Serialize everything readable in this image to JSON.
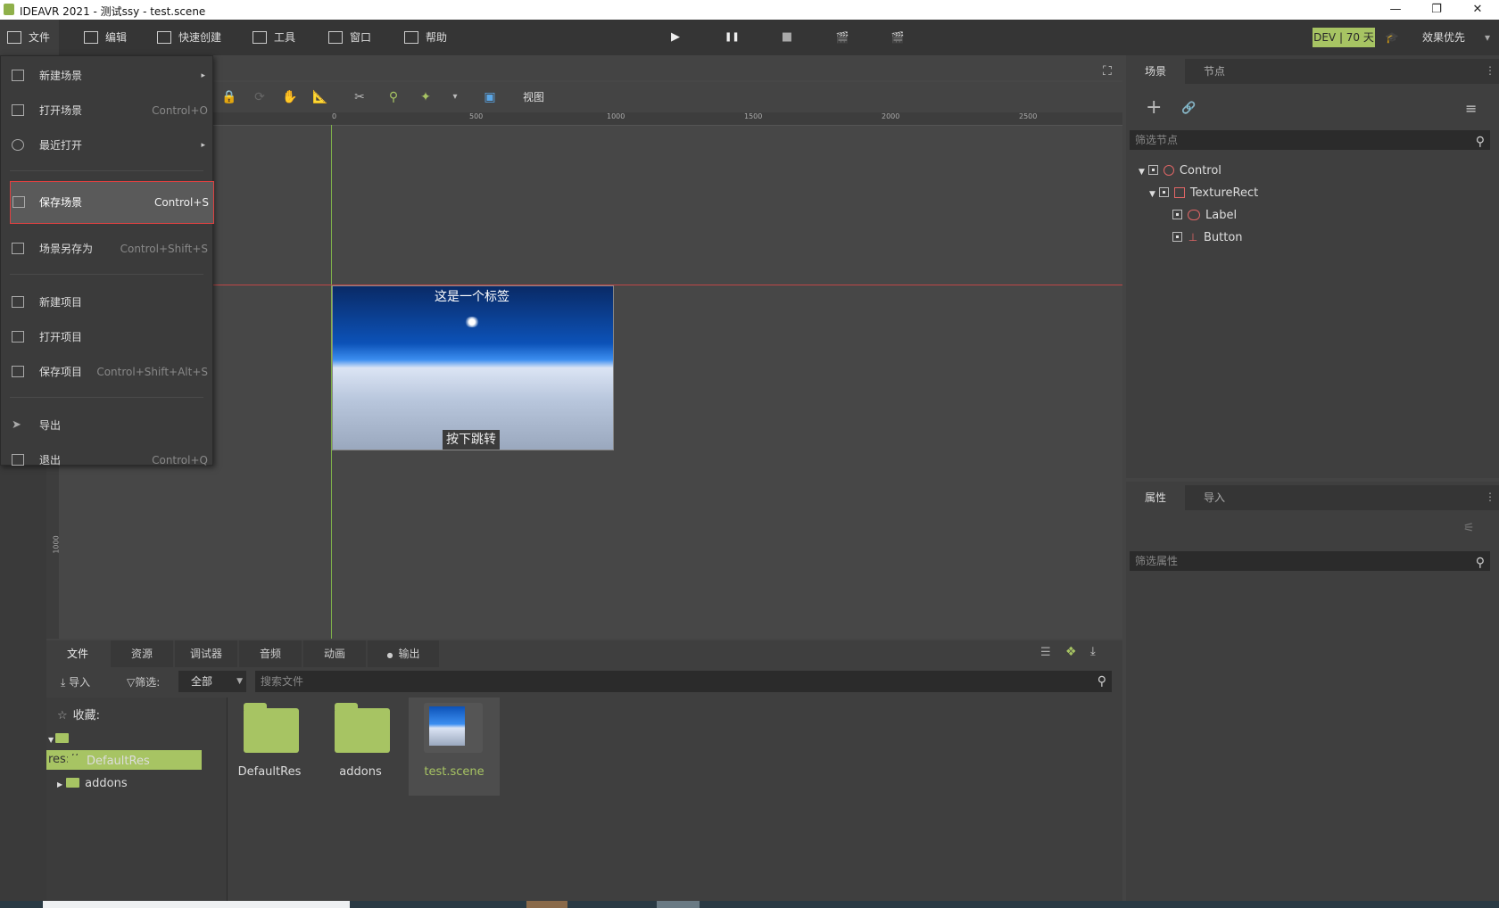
{
  "window": {
    "title": "IDEAVR 2021 - 测试ssy - test.scene",
    "minimize": "—",
    "restore": "❐",
    "close": "✕"
  },
  "menubar": {
    "items": [
      {
        "label": "文件"
      },
      {
        "label": "编辑"
      },
      {
        "label": "快速创建"
      },
      {
        "label": "工具"
      },
      {
        "label": "窗口"
      },
      {
        "label": "帮助"
      }
    ],
    "play": "▶",
    "pause": "❚❚",
    "stop": "■",
    "movie1": "🎬",
    "movie2": "🎬",
    "dev_badge": "DEV | 70 天",
    "cap": "🎓",
    "quality": "效果优先",
    "quality_arrow": "▾"
  },
  "filemenu": {
    "items": [
      {
        "label": "新建场景",
        "shortcut": "",
        "arrow": "▸"
      },
      {
        "label": "打开场景",
        "shortcut": "Control+O",
        "arrow": ""
      },
      {
        "label": "最近打开",
        "shortcut": "",
        "arrow": "▸"
      },
      {
        "label": "保存场景",
        "shortcut": "Control+S",
        "arrow": ""
      },
      {
        "label": "场景另存为",
        "shortcut": "Control+Shift+S",
        "arrow": ""
      },
      {
        "label": "新建项目",
        "shortcut": "",
        "arrow": ""
      },
      {
        "label": "打开项目",
        "shortcut": "",
        "arrow": ""
      },
      {
        "label": "保存项目",
        "shortcut": "Control+Shift+Alt+S",
        "arrow": ""
      },
      {
        "label": "导出",
        "shortcut": "",
        "arrow": ""
      },
      {
        "label": "退出",
        "shortcut": "Control+Q",
        "arrow": ""
      }
    ]
  },
  "viewport": {
    "view_label": "视图",
    "ruler_h": [
      "0",
      "500",
      "1000",
      "1500",
      "2000",
      "2500"
    ],
    "ruler_v": "1000",
    "scene_label": "这是一个标签",
    "scene_button": "按下跳转"
  },
  "scene_panel": {
    "tabs": [
      "场景",
      "节点"
    ],
    "add": "+",
    "link": "🔗",
    "menu": "≡",
    "filter_placeholder": "筛选节点",
    "nodes": [
      "Control",
      "TextureRect",
      "Label",
      "Button"
    ]
  },
  "inspector": {
    "tabs": [
      "属性",
      "导入"
    ],
    "filter_placeholder": "筛选属性"
  },
  "bottom_dock": {
    "tabs": [
      "文件",
      "资源",
      "调试器",
      "音频",
      "动画",
      "输出"
    ],
    "import_label": "导入",
    "filter_label": "筛选:",
    "filter_value": "全部",
    "search_placeholder": "搜索文件",
    "tree": {
      "favorites": "收藏:",
      "root": "res://",
      "children": [
        "DefaultRes",
        "addons"
      ]
    },
    "files": [
      "DefaultRes",
      "addons",
      "test.scene"
    ]
  }
}
